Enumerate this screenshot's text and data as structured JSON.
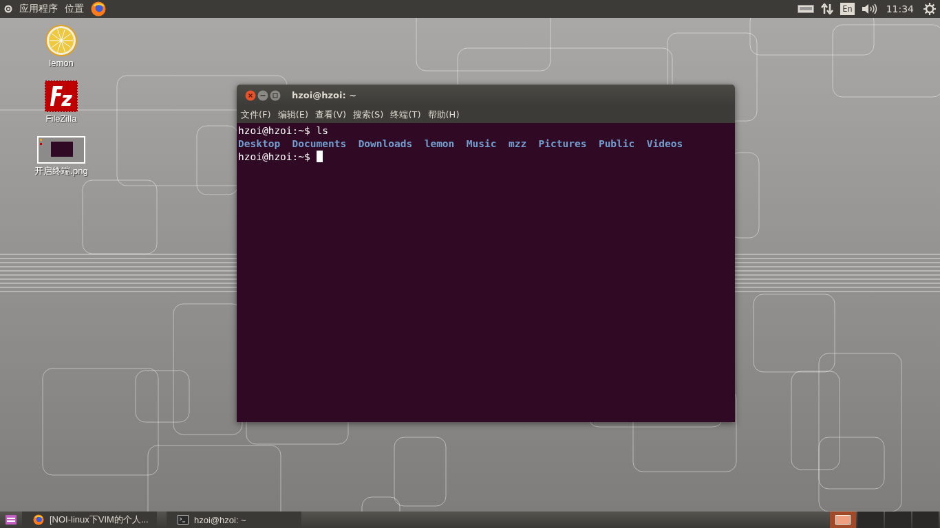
{
  "top_bar": {
    "menus": [
      "应用程序",
      "位置"
    ],
    "indicators": [
      {
        "kind": "keyboard"
      },
      {
        "kind": "network"
      },
      {
        "kind": "language",
        "text": "En"
      },
      {
        "kind": "volume"
      },
      {
        "kind": "clock",
        "text": "11:34"
      },
      {
        "kind": "system"
      }
    ]
  },
  "desktop_icons": [
    {
      "kind": "lemon",
      "label": "lemon"
    },
    {
      "kind": "filezilla",
      "label": "FileZilla"
    },
    {
      "kind": "image",
      "label": "开启终端.png"
    }
  ],
  "terminal": {
    "title": "hzoi@hzoi: ~",
    "menu": [
      "文件(F)",
      "编辑(E)",
      "查看(V)",
      "搜索(S)",
      "终端(T)",
      "帮助(H)"
    ],
    "lines": [
      {
        "kind": "command",
        "text": "hzoi@hzoi:~$ ls"
      },
      {
        "kind": "listing",
        "items": [
          "Desktop",
          "Documents",
          "Downloads",
          "lemon",
          "Music",
          "mzz",
          "Pictures",
          "Public",
          "Videos"
        ]
      },
      {
        "kind": "prompt",
        "text": "hzoi@hzoi:~$ ",
        "cursor": true
      }
    ]
  },
  "taskbar": {
    "items": [
      {
        "kind": "browser",
        "label": "[NOI-linux下VIM的个人..."
      },
      {
        "kind": "terminal",
        "label": "hzoi@hzoi: ~"
      }
    ],
    "workspaces": [
      {
        "selected": true
      },
      {
        "selected": false
      },
      {
        "selected": false
      },
      {
        "selected": false
      }
    ]
  }
}
